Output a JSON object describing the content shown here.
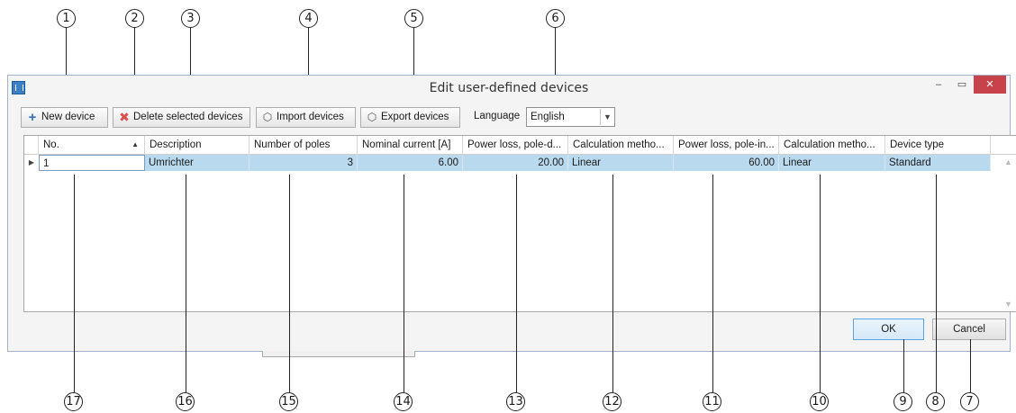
{
  "window": {
    "title": "Edit user-defined devices",
    "minimize": "–",
    "maximize": "▭",
    "close": "✕"
  },
  "toolbar": {
    "new_device": "New device",
    "delete_selected": "Delete selected devices",
    "import_devices": "Import devices",
    "export_devices": "Export devices",
    "language_label": "Language",
    "language_value": "English"
  },
  "icons": {
    "new": "plus-icon",
    "delete": "delete-x-icon",
    "import": "import-box-icon",
    "export": "export-box-icon"
  },
  "grid": {
    "columns": [
      "No.",
      "Description",
      "Number of poles",
      "Nominal current [A]",
      "Power loss, pole-d...",
      "Calculation metho...",
      "Power loss, pole-in...",
      "Calculation metho...",
      "Device type"
    ],
    "rows": [
      [
        "1",
        "Umrichter",
        "3",
        "6.00",
        "20.00",
        "Linear",
        "60.00",
        "Linear",
        "Standard"
      ]
    ]
  },
  "buttons": {
    "ok": "OK",
    "cancel": "Cancel"
  },
  "callouts": [
    "1",
    "2",
    "3",
    "4",
    "5",
    "6",
    "17",
    "16",
    "15",
    "14",
    "13",
    "12",
    "11",
    "10",
    "9",
    "8",
    "7"
  ],
  "colors": {
    "selection": "#b9daee",
    "close_button": "#c7424a",
    "accent": "#2f6fbd"
  }
}
